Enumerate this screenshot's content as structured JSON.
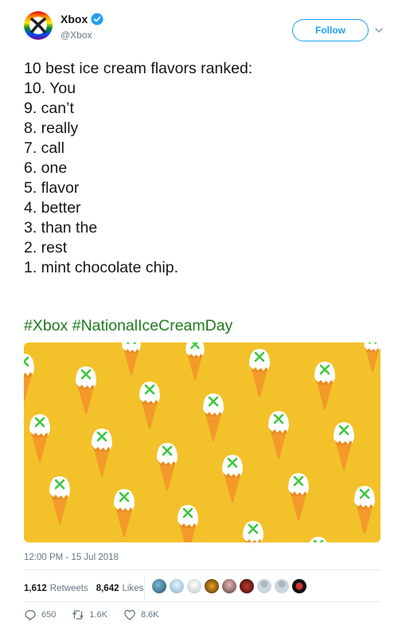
{
  "author": {
    "display_name": "Xbox",
    "handle": "@Xbox",
    "verified_icon": "verified-badge-icon",
    "avatar_icon": "xbox-logo-icon",
    "brand_color": "#107c10"
  },
  "follow": {
    "label": "Follow",
    "color": "#1da1f2"
  },
  "tweet": {
    "lines": [
      "10 best ice cream flavors ranked:",
      "",
      "10. You",
      "9. can’t",
      "8. really",
      "7. call",
      "6. one",
      "5. flavor",
      "4. better",
      "3. than the",
      "2. rest",
      "1. mint chocolate chip."
    ],
    "hashtags": [
      "#Xbox",
      "#NationalIceCreamDay"
    ]
  },
  "media": {
    "background_color": "#f3c22a",
    "motif": "ice-cream-cone-with-xbox-logo"
  },
  "timestamp": "12:00 PM - 15 Jul 2018",
  "stats": {
    "retweets_count": "1,612",
    "retweets_label": "Retweets",
    "likes_count": "8,642",
    "likes_label": "Likes"
  },
  "actions": {
    "reply_count": "650",
    "retweet_count": "1.6K",
    "like_count": "8.6K"
  }
}
